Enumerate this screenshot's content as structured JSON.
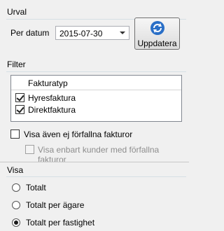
{
  "urval": {
    "title": "Urval",
    "per_datum_label": "Per datum",
    "date_value": "2015-07-30",
    "update_button_label": "Uppdatera"
  },
  "filter": {
    "title": "Filter",
    "column_header": "Fakturatyp",
    "rows": [
      {
        "label": "Hyresfaktura",
        "checked": true
      },
      {
        "label": "Direktfaktura",
        "checked": true
      }
    ],
    "show_unexpired_label": "Visa även ej förfallna fakturor",
    "show_unexpired_checked": false,
    "only_customers_label": "Visa enbart kunder med förfallna fakturor",
    "only_customers_checked": false
  },
  "visa": {
    "title": "Visa",
    "options": [
      {
        "label": "Totalt",
        "selected": false
      },
      {
        "label": "Totalt per ägare",
        "selected": false
      },
      {
        "label": "Totalt per fastighet",
        "selected": true
      }
    ]
  },
  "colors": {
    "background": "#f0f0f0",
    "group_line": "#d5dfe5",
    "icon_blue": "#2a6fc7"
  }
}
